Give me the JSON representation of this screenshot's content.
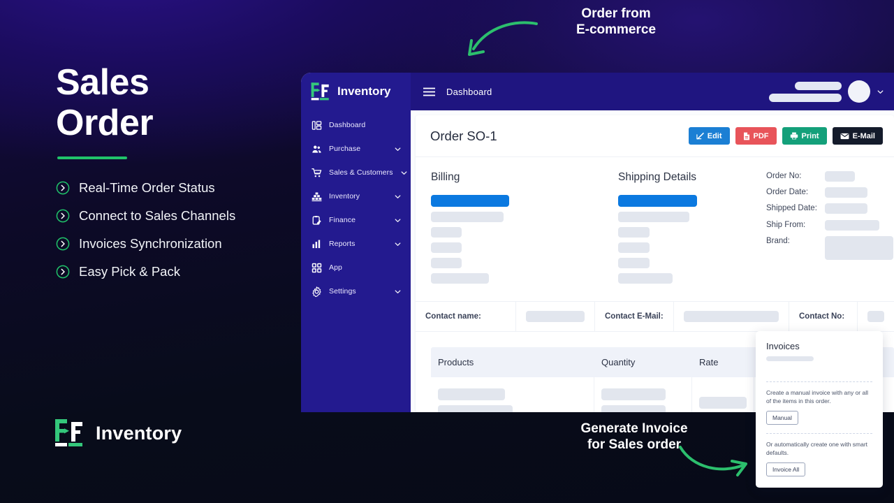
{
  "promo": {
    "title_line1": "Sales",
    "title_line2": "Order",
    "features": [
      {
        "label": "Real-Time Order Status",
        "icon": "chevron-circle-right-icon"
      },
      {
        "label": "Connect to Sales Channels",
        "icon": "chevron-circle-right-icon"
      },
      {
        "label": "Invoices Synchronization",
        "icon": "chevron-circle-right-icon"
      },
      {
        "label": "Easy Pick & Pack",
        "icon": "chevron-circle-right-icon"
      }
    ],
    "brand_word": "Inventory",
    "accent_green": "#20c36a"
  },
  "annotations": {
    "top": "Order from\nE-commerce",
    "top_line1": "Order from",
    "top_line2": "E-commerce",
    "bottom_line1": "Generate Invoice",
    "bottom_line2": "for Sales order",
    "arrow_color": "#2cbf6d"
  },
  "app": {
    "sidebar": {
      "brand": "Inventory",
      "bg": "#231a8f",
      "items": [
        {
          "label": "Dashboard",
          "icon": "dashboard-icon",
          "expandable": false
        },
        {
          "label": "Purchase",
          "icon": "users-icon",
          "expandable": true
        },
        {
          "label": "Sales & Customers",
          "icon": "cart-icon",
          "expandable": true
        },
        {
          "label": "Inventory",
          "icon": "boxes-icon",
          "expandable": true
        },
        {
          "label": "Finance",
          "icon": "clipboard-pen-icon",
          "expandable": true
        },
        {
          "label": "Reports",
          "icon": "bar-chart-icon",
          "expandable": true
        },
        {
          "label": "App",
          "icon": "grid-icon",
          "expandable": false
        },
        {
          "label": "Settings",
          "icon": "gear-icon",
          "expandable": true
        }
      ]
    },
    "topbar": {
      "menu_icon": "hamburger-icon",
      "title": "Dashboard",
      "caret_icon": "chevron-down-icon"
    },
    "order": {
      "title": "Order SO-1",
      "actions": [
        {
          "label": "Edit",
          "icon": "pencil-square-icon",
          "color": "#1b7fd4"
        },
        {
          "label": "PDF",
          "icon": "file-pdf-icon",
          "color": "#e8545a"
        },
        {
          "label": "Print",
          "icon": "printer-icon",
          "color": "#14a07a"
        },
        {
          "label": "E-Mail",
          "icon": "envelope-icon",
          "color": "#141b2b"
        }
      ],
      "billing_heading": "Billing",
      "shipping_heading": "Shipping Details",
      "meta_labels": [
        "Order No:",
        "Order Date:",
        "Shipped Date:",
        "Ship From:",
        "Brand:"
      ],
      "contact_fields": [
        {
          "label": "Contact name:"
        },
        {
          "label": "Contact E-Mail:"
        },
        {
          "label": "Contact No:"
        }
      ],
      "table_headers": [
        "Products",
        "Quantity",
        "Rate"
      ]
    },
    "invoices_popover": {
      "title": "Invoices",
      "manual_text": "Create a manual invoice with any or all of the items in this order.",
      "manual_button": "Manual",
      "auto_text": "Or automatically create one with smart defaults.",
      "auto_button": "Invoice All"
    }
  }
}
